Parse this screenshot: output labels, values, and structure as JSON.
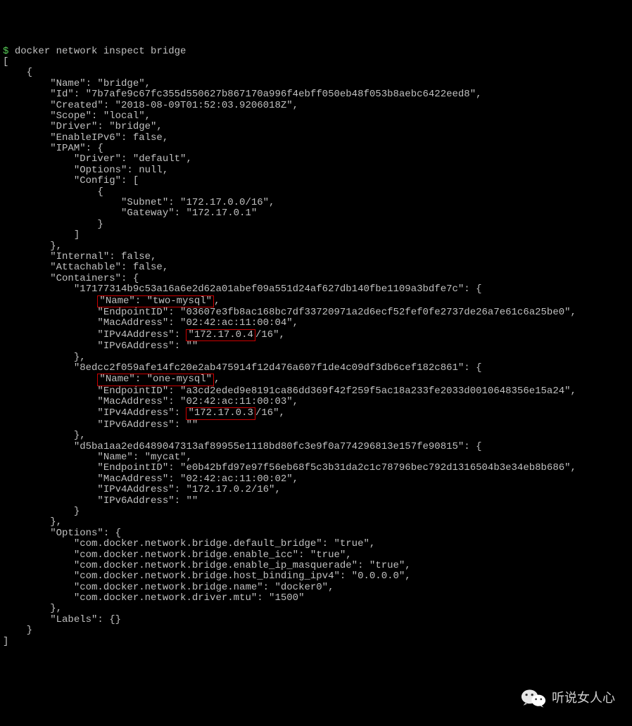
{
  "prompt": "$",
  "command": "docker network inspect bridge",
  "json_output": {
    "open_bracket": "[",
    "open_brace": "    {",
    "Name": "        \"Name\": \"bridge\",",
    "Id": "        \"Id\": \"7b7afe9c67fc355d550627b867170a996f4ebff050eb48f053b8aebc6422eed8\",",
    "Created": "        \"Created\": \"2018-08-09T01:52:03.9206018Z\",",
    "Scope": "        \"Scope\": \"local\",",
    "Driver": "        \"Driver\": \"bridge\",",
    "EnableIPv6": "        \"EnableIPv6\": false,",
    "IPAM_open": "        \"IPAM\": {",
    "IPAM_Driver": "            \"Driver\": \"default\",",
    "IPAM_Options": "            \"Options\": null,",
    "IPAM_Config_open": "            \"Config\": [",
    "IPAM_Config_brace": "                {",
    "IPAM_Subnet": "                    \"Subnet\": \"172.17.0.0/16\",",
    "IPAM_Gateway": "                    \"Gateway\": \"172.17.0.1\"",
    "IPAM_Config_brace_close": "                }",
    "IPAM_Config_close": "            ]",
    "IPAM_close": "        },",
    "Internal": "        \"Internal\": false,",
    "Attachable": "        \"Attachable\": false,",
    "Containers_open": "        \"Containers\": {",
    "c1_id": "            \"17177314b9c53a16a6e2d62a01abef09a551d24af627db140fbe1109a3bdfe7c\": {",
    "c1_name_pre": "                ",
    "c1_name_box": "\"Name\": \"two-mysql\"",
    "c1_name_post": ",",
    "c1_endpoint": "                \"EndpointID\": \"03607e3fb8ac168bc7df33720971a2d6ecf52fef0fe2737de26a7e61c6a25be0\",",
    "c1_mac": "                \"MacAddress\": \"02:42:ac:11:00:04\",",
    "c1_ipv4_pre": "                \"IPv4Address\": ",
    "c1_ipv4_box": "\"172.17.0.4",
    "c1_ipv4_post": "/16\",",
    "c1_ipv6": "                \"IPv6Address\": \"\"",
    "c1_close": "            },",
    "c2_id": "            \"8edcc2f059afe14fc20e2ab475914f12d476a607f1de4c09df3db6cef182c861\": {",
    "c2_name_pre": "                ",
    "c2_name_box": "\"Name\": \"one-mysql\"",
    "c2_name_post": ",",
    "c2_endpoint": "                \"EndpointID\": \"a3cd2eded9e8191ca86dd369f42f259f5ac18a233fe2033d0010648356e15a24\",",
    "c2_mac": "                \"MacAddress\": \"02:42:ac:11:00:03\",",
    "c2_ipv4_pre": "                \"IPv4Address\": ",
    "c2_ipv4_box": "\"172.17.0.3",
    "c2_ipv4_post": "/16\",",
    "c2_ipv6": "                \"IPv6Address\": \"\"",
    "c2_close": "            },",
    "c3_id": "            \"d5ba1aa2ed6489047313af89955e1118bd80fc3e9f0a774296813e157fe90815\": {",
    "c3_name": "                \"Name\": \"mycat\",",
    "c3_endpoint": "                \"EndpointID\": \"e0b42bfd97e97f56eb68f5c3b31da2c1c78796bec792d1316504b3e34eb8b686\",",
    "c3_mac": "                \"MacAddress\": \"02:42:ac:11:00:02\",",
    "c3_ipv4": "                \"IPv4Address\": \"172.17.0.2/16\",",
    "c3_ipv6": "                \"IPv6Address\": \"\"",
    "c3_close": "            }",
    "Containers_close": "        },",
    "Options_open": "        \"Options\": {",
    "opt1": "            \"com.docker.network.bridge.default_bridge\": \"true\",",
    "opt2": "            \"com.docker.network.bridge.enable_icc\": \"true\",",
    "opt3": "            \"com.docker.network.bridge.enable_ip_masquerade\": \"true\",",
    "opt4": "            \"com.docker.network.bridge.host_binding_ipv4\": \"0.0.0.0\",",
    "opt5": "            \"com.docker.network.bridge.name\": \"docker0\",",
    "opt6": "            \"com.docker.network.driver.mtu\": \"1500\"",
    "Options_close": "        },",
    "Labels": "        \"Labels\": {}",
    "close_brace": "    }",
    "close_bracket": "]"
  },
  "watermark_text": "听说女人心"
}
